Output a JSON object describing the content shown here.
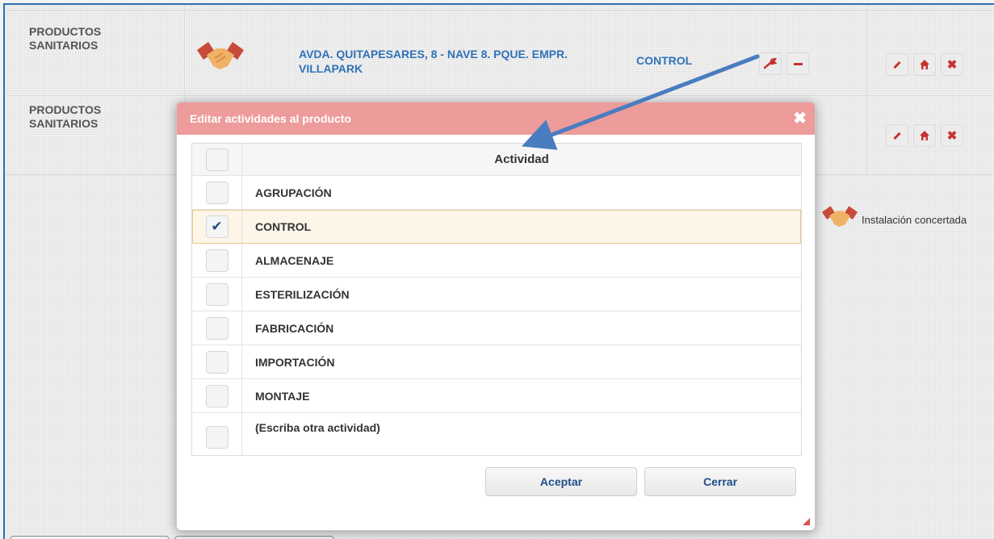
{
  "background_table": {
    "rows": [
      {
        "type": "PRODUCTOS SANITARIOS",
        "address": "AVDA. QUITAPESARES, 8 - NAVE 8. PQUE. EMPR. VILLAPARK",
        "activity": "CONTROL"
      },
      {
        "type": "PRODUCTOS SANITARIOS"
      }
    ]
  },
  "legend": {
    "icon": "handshake-icon",
    "label": "Instalación concertada"
  },
  "dialog": {
    "title": "Editar actividades al producto",
    "close_symbol": "✖",
    "column_header": "Actividad",
    "items": [
      {
        "label": "AGRUPACIÓN",
        "checked": false
      },
      {
        "label": "CONTROL",
        "checked": true
      },
      {
        "label": "ALMACENAJE",
        "checked": false
      },
      {
        "label": "ESTERILIZACIÓN",
        "checked": false
      },
      {
        "label": "FABRICACIÓN",
        "checked": false
      },
      {
        "label": "IMPORTACIÓN",
        "checked": false
      },
      {
        "label": "MONTAJE",
        "checked": false
      },
      {
        "label": "(Escriba otra actividad)",
        "checked": false
      }
    ],
    "accept_label": "Aceptar",
    "close_label": "Cerrar"
  },
  "check_mark": "✔",
  "colors": {
    "dialog_header": "#ee9b9b",
    "link_blue": "#2e72b8",
    "action_red": "#c83232",
    "annotation_arrow": "#4a7cc0"
  }
}
